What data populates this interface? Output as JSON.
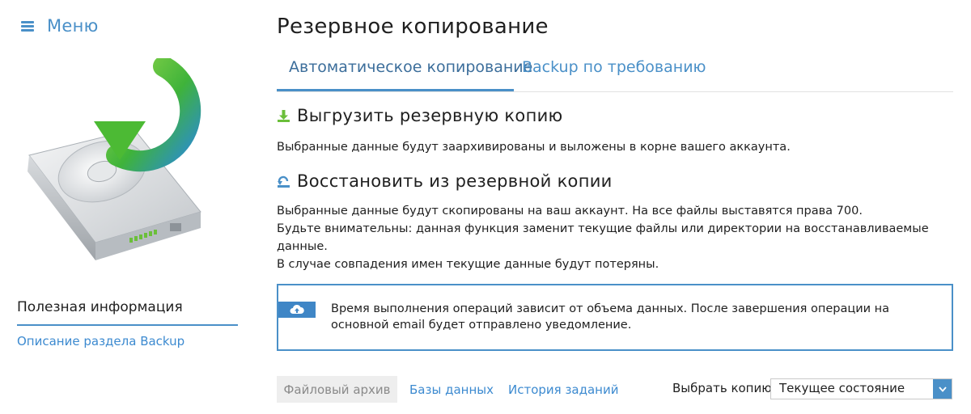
{
  "sidebar": {
    "menu_label": "Меню",
    "info_title": "Полезная информация",
    "info_link": "Описание раздела Backup"
  },
  "main": {
    "title": "Резервное копирование",
    "tabs": [
      {
        "label": "Автоматическое копирование",
        "active": true
      },
      {
        "label": "Backup по требованию",
        "active": false
      }
    ],
    "sections": [
      {
        "icon": "download-icon",
        "title": "Выгрузить резервную копию",
        "lines": [
          "Выбранные данные будут заархивированы и выложены в корне вашего аккаунта."
        ]
      },
      {
        "icon": "restore-icon",
        "title": "Восстановить из резервной копии",
        "lines": [
          "Выбранные данные будут скопированы на ваш аккаунт. На все файлы выставятся права 700.",
          "Будьте внимательны: данная функция заменит текущие файлы или директории на восстанавливаемые данные.",
          "В случае совпадения имен текущие данные будут потеряны."
        ]
      }
    ],
    "notice": {
      "icon": "cloud-icon",
      "text": "Время выполнения операций зависит от объема данных. После завершения операции на основной email будет отправлено уведомление."
    },
    "subtabs": [
      {
        "label": "Файловый архив",
        "active": true
      },
      {
        "label": "Базы данных",
        "active": false
      },
      {
        "label": "История заданий",
        "active": false
      }
    ],
    "select": {
      "label": "Выбрать копию:",
      "value": "Текущее состояние"
    }
  },
  "colors": {
    "accent": "#4a90c8",
    "link": "#3c8ad0",
    "text": "#1f1f1f",
    "green": "#5fbf2a"
  }
}
